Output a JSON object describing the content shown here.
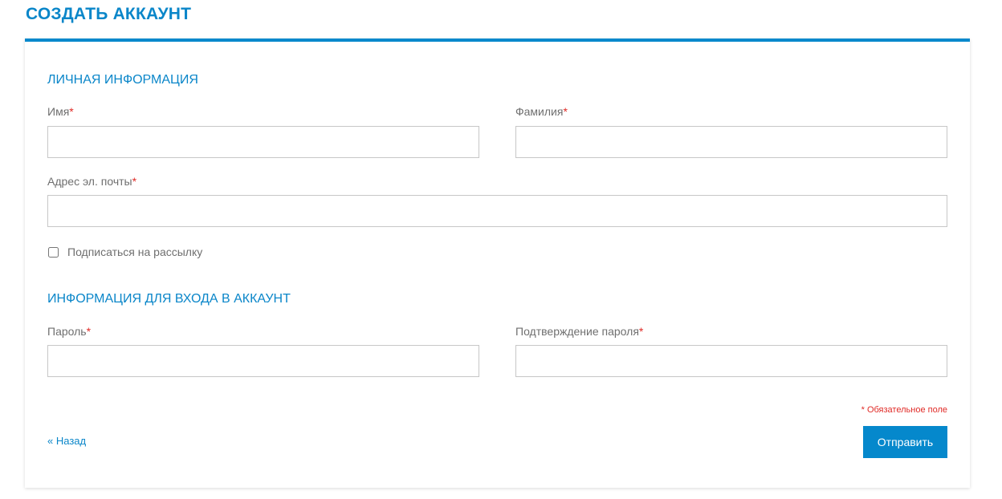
{
  "page_title": "СОЗДАТЬ АККАУНТ",
  "personal": {
    "heading": "ЛИЧНАЯ ИНФОРМАЦИЯ",
    "first_name_label": "Имя",
    "last_name_label": "Фамилия",
    "email_label": "Адрес эл. почты",
    "newsletter_label": "Подписаться на рассылку",
    "newsletter_checked": false
  },
  "login": {
    "heading": "ИНФОРМАЦИЯ ДЛЯ ВХОДА В АККАУНТ",
    "password_label": "Пароль",
    "confirm_label": "Подтверждение пароля"
  },
  "required_mark": "*",
  "required_note": "* Обязательное поле",
  "back_link": "« Назад",
  "submit_label": "Отправить",
  "colors": {
    "accent": "#0588cc",
    "required": "#e02b27"
  }
}
